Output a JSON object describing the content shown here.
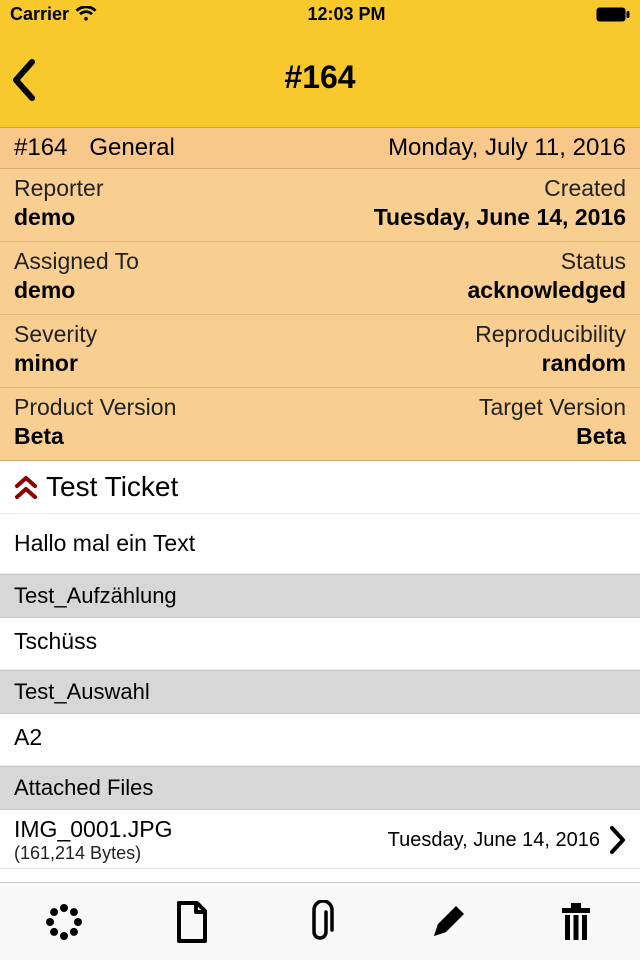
{
  "status_bar": {
    "carrier": "Carrier",
    "time": "12:03 PM"
  },
  "nav": {
    "title": "#164"
  },
  "header": {
    "id": "#164",
    "category": "General",
    "date": "Monday, July 11, 2016"
  },
  "fields": {
    "reporter_label": "Reporter",
    "reporter": "demo",
    "created_label": "Created",
    "created": "Tuesday, June 14, 2016",
    "assigned_label": "Assigned To",
    "assigned": "demo",
    "status_label": "Status",
    "status": "acknowledged",
    "severity_label": "Severity",
    "severity": "minor",
    "reproducibility_label": "Reproducibility",
    "reproducibility": "random",
    "product_version_label": "Product Version",
    "product_version": "Beta",
    "target_version_label": "Target Version",
    "target_version": "Beta"
  },
  "ticket": {
    "title": "Test Ticket",
    "description": "Hallo mal ein Text"
  },
  "custom": [
    {
      "label": "Test_Aufzählung",
      "value": "Tschüss"
    },
    {
      "label": "Test_Auswahl",
      "value": "A2"
    }
  ],
  "attachments": {
    "header": "Attached Files",
    "items": [
      {
        "name": "IMG_0001.JPG",
        "size": "(161,214 Bytes)",
        "date": "Tuesday, June 14, 2016"
      }
    ]
  }
}
